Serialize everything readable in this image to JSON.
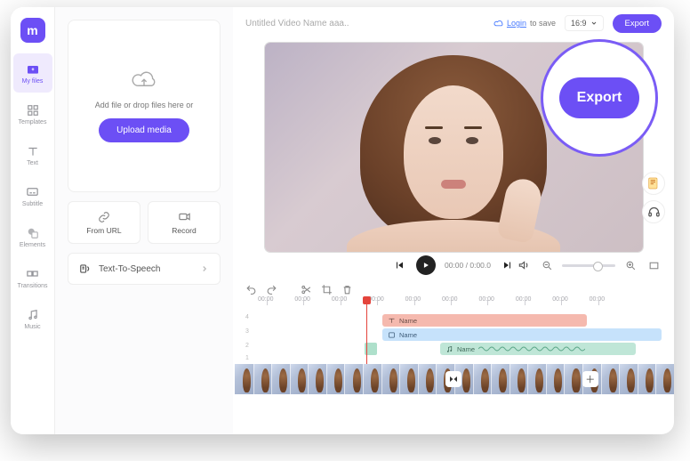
{
  "brand": {
    "logo_text": "m"
  },
  "rail": {
    "items": [
      {
        "label": "My files"
      },
      {
        "label": "Templates"
      },
      {
        "label": "Text"
      },
      {
        "label": "Subtitle"
      },
      {
        "label": "Elements"
      },
      {
        "label": "Transitions"
      },
      {
        "label": "Music"
      }
    ]
  },
  "panel": {
    "drop_hint": "Add file or drop files here or",
    "upload_label": "Upload media",
    "from_url_label": "From URL",
    "record_label": "Record",
    "tts_label": "Text-To-Speech"
  },
  "topbar": {
    "title": "Untitled Video Name aaa..",
    "login_label": "Login",
    "to_save_label": "to save",
    "aspect": "16:9",
    "export_label": "Export"
  },
  "player": {
    "current_time": "00:00",
    "total_time": "0:00.0"
  },
  "ruler": {
    "ticks": [
      "00:00",
      "00:00",
      "00:00",
      "00:00",
      "00:00",
      "00:00",
      "00:00",
      "00:00",
      "00:00",
      "00:00"
    ]
  },
  "tracks": {
    "row_labels": [
      "4",
      "3",
      "2",
      "1"
    ],
    "clips": {
      "text_name": "Name",
      "video_name": "Name",
      "audio_name": "Name"
    }
  },
  "callout": {
    "export_big": "Export"
  }
}
